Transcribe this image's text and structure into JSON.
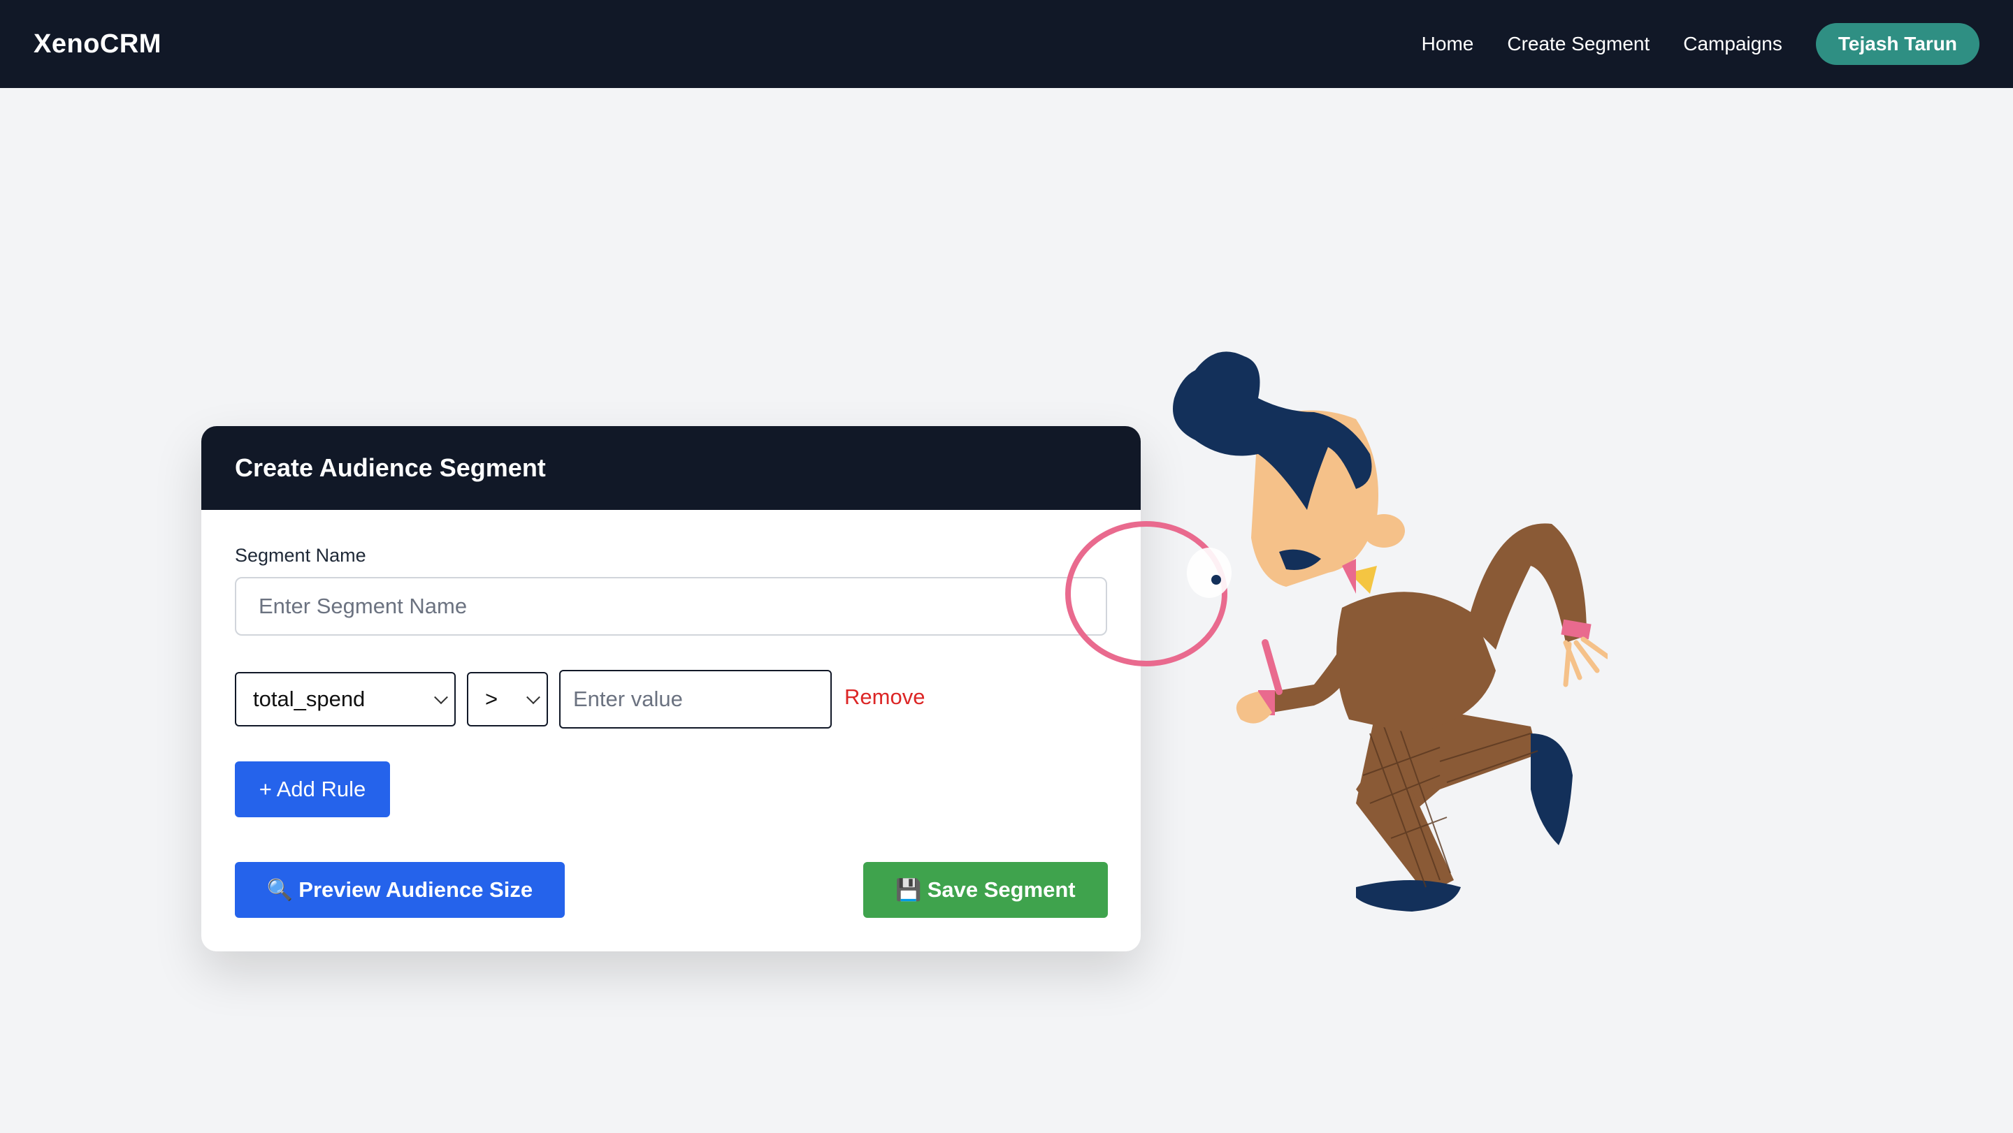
{
  "navbar": {
    "brand": "XenoCRM",
    "links": [
      "Home",
      "Create Segment",
      "Campaigns"
    ],
    "user": "Tejash Tarun"
  },
  "card": {
    "title": "Create Audience Segment",
    "segment_name_label": "Segment Name",
    "segment_name_placeholder": "Enter Segment Name",
    "rule": {
      "field": "total_spend",
      "operator": ">",
      "value_placeholder": "Enter value",
      "remove_label": "Remove"
    },
    "add_rule_label": "+ Add Rule",
    "preview_icon": "🔍",
    "preview_label": "Preview Audience Size",
    "save_icon": "💾",
    "save_label": "Save Segment"
  },
  "colors": {
    "navbar_bg": "#111827",
    "user_button": "#2f8f83",
    "primary_button": "#2563eb",
    "save_button": "#3fa34d",
    "remove_link": "#dc2626",
    "page_bg": "#f3f4f6"
  },
  "illustration": {
    "icon": "detective-with-magnifying-glass-illustration"
  }
}
